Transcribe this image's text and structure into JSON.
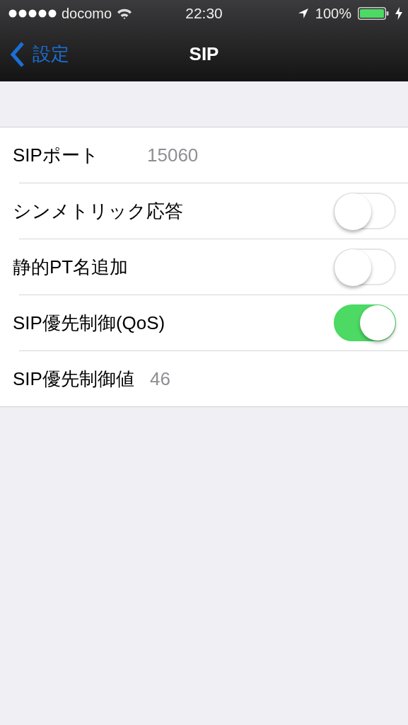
{
  "status_bar": {
    "carrier": "docomo",
    "time": "22:30",
    "battery": "100%"
  },
  "nav": {
    "back": "設定",
    "title": "SIP"
  },
  "rows": [
    {
      "kind": "field",
      "label": "SIPポート",
      "value": "15060"
    },
    {
      "kind": "toggle",
      "label": "シンメトリック応答",
      "on": false
    },
    {
      "kind": "toggle",
      "label": "静的PT名追加",
      "on": false
    },
    {
      "kind": "toggle",
      "label": "SIP優先制御(QoS)",
      "on": true
    },
    {
      "kind": "field",
      "label": "SIP優先制御値",
      "value": "46"
    }
  ]
}
